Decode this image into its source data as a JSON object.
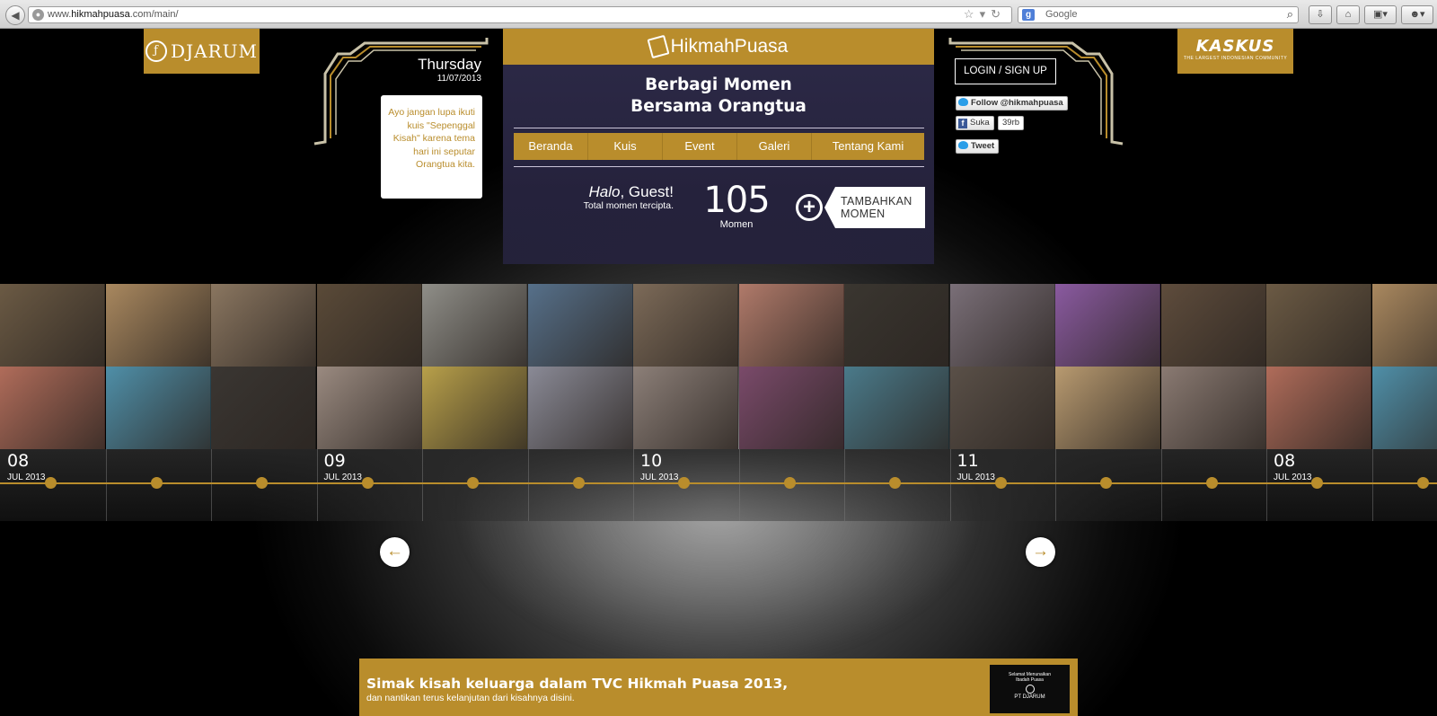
{
  "browser": {
    "url_domain_prefix": "www.",
    "url_domain": "hikmahpuasa",
    "url_domain_suffix": ".com",
    "url_path": "/main/",
    "search_engine_label": "g",
    "search_placeholder": "Google"
  },
  "brands": {
    "left_logo": "DJARUM",
    "right_logo": "KASKUS",
    "right_logo_tagline": "THE LARGEST INDONESIAN COMMUNITY",
    "site_logo": "HikmahPuasa",
    "gold": "#b98d2c",
    "panel_color": "#2a2743"
  },
  "date_box": {
    "day": "Thursday",
    "date": "11/07/2013",
    "note": "Ayo jangan lupa ikuti kuis \"Sepenggal Kisah\" karena tema hari ini seputar Orangtua kita."
  },
  "center": {
    "headline_1": "Berbagi Momen",
    "headline_2": "Bersama Orangtua",
    "nav": [
      "Beranda",
      "Kuis",
      "Event",
      "Galeri",
      "Tentang Kami"
    ],
    "greeting_halo": "Halo",
    "greeting_name": ", Guest!",
    "greeting_sub": "Total momen tercipta.",
    "moment_count": "105",
    "moment_label": "Momen",
    "add_label_1": "TAMBAHKAN",
    "add_label_2": "MOMEN"
  },
  "account": {
    "login": "LOGIN / SIGN UP",
    "follow": "Follow @hikmahpuasa",
    "like": "Suka",
    "like_count": "39rb",
    "tweet": "Tweet"
  },
  "timeline": {
    "dates": [
      {
        "day": "08",
        "month": "JUL 2013"
      },
      {
        "day": "09",
        "month": "JUL 2013"
      },
      {
        "day": "10",
        "month": "JUL 2013"
      },
      {
        "day": "11",
        "month": "JUL 2013"
      },
      {
        "day": "08",
        "month": "JUL 2013"
      }
    ],
    "photo_colors_top": [
      "#6b5a44",
      "#a9885f",
      "#8a7660",
      "#5a4a38",
      "#8f8e88",
      "#56708a",
      "#7c6a58",
      "#b07a6a",
      "#3a3630",
      "#7a6f78",
      "#8a5aa0",
      "#5e4c3c",
      "#6b5a44",
      "#a9885f"
    ],
    "photo_colors_bottom": [
      "#b06c5a",
      "#4f8fa8",
      "#3a3632",
      "#9a8a80",
      "#b8a04a",
      "#8a8a96",
      "#8c7f78",
      "#7a4a6a",
      "#4a7a8a",
      "#5a5048",
      "#b89a70",
      "#8a7a72",
      "#b06c5a",
      "#4f8fa8"
    ]
  },
  "banner": {
    "title": "Simak kisah keluarga dalam TVC Hikmah Puasa 2013,",
    "subtitle": "dan nantikan terus kelanjutan dari kisahnya disini.",
    "thumb_line_1": "Selamat Menunaikan",
    "thumb_line_2": "Ibadah Puasa",
    "thumb_brand": "PT DJARUM"
  }
}
